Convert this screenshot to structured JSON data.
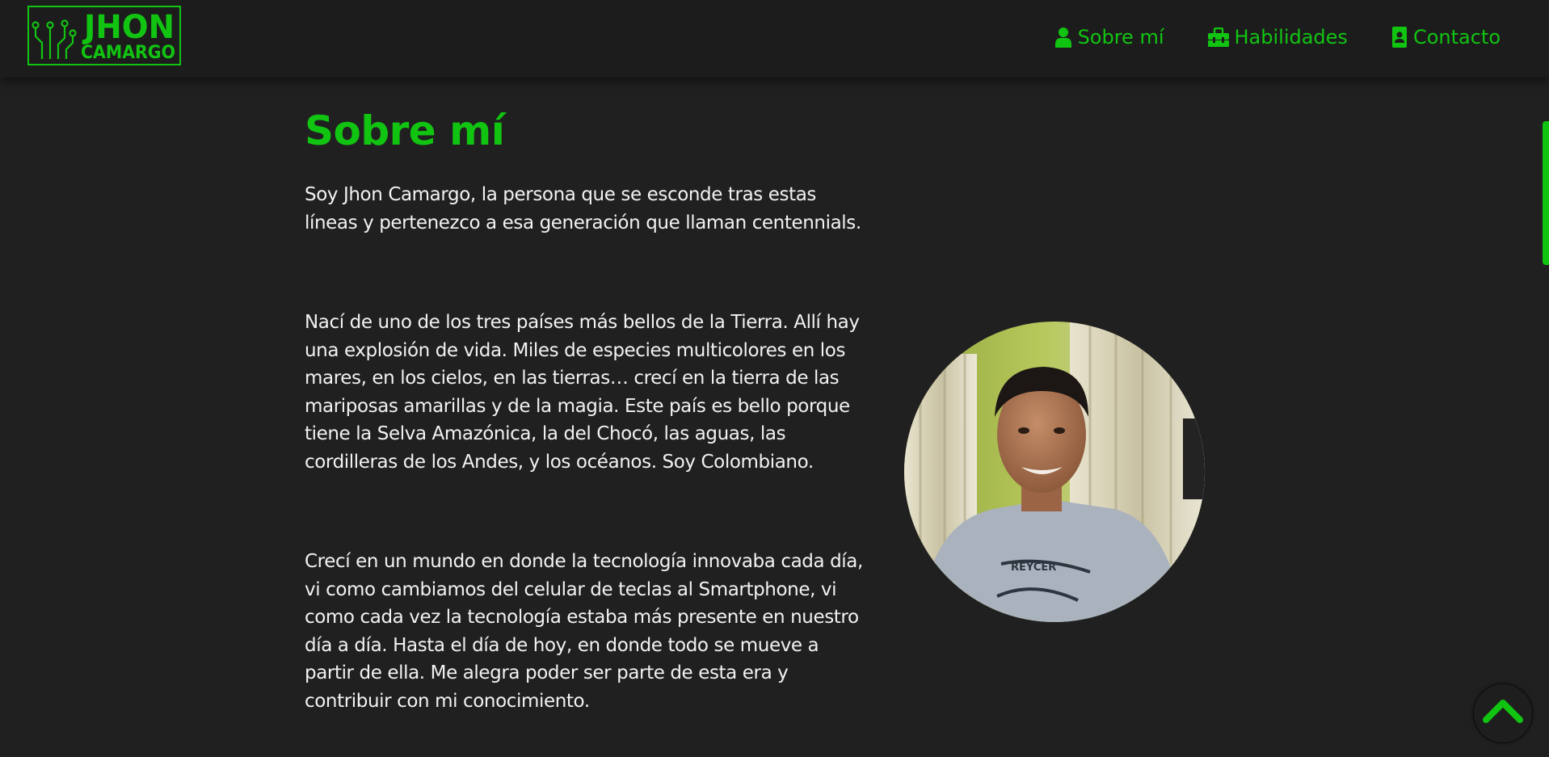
{
  "brand": {
    "line1": "JHON",
    "line2": "CAMARGO",
    "accent_color": "#12c412"
  },
  "nav": [
    {
      "icon": "user-icon",
      "label": "Sobre mí"
    },
    {
      "icon": "toolbox-icon",
      "label": "Habilidades"
    },
    {
      "icon": "contact-card-icon",
      "label": "Contacto"
    }
  ],
  "about": {
    "title": "Sobre mí",
    "paragraphs": [
      "Soy Jhon Camargo, la persona que se esconde tras estas líneas y pertenezco a esa generación que llaman centennials.",
      "Nací de uno de los tres países más bellos de la Tierra. Allí hay una explosión de vida. Miles de especies multicolores en los mares, en los cielos, en las tierras… crecí en la tierra de las mariposas amarillas y de la magia. Este país es bello porque tiene la Selva Amazónica, la del Chocó, las aguas, las cordilleras de los Andes, y los océanos. Soy Colombiano.",
      "Crecí en un mundo en donde la tecnología innovaba cada día, vi como cambiamos del celular de teclas al Smartphone, vi como cada vez la tecnología estaba más presente en nuestro día a día. Hasta el día de hoy, en donde todo se mueve a partir de ella. Me alegra poder ser parte de esta era y contribuir con mi conocimiento."
    ],
    "photo_shirt_text": "REYCER"
  },
  "back_to_top": {
    "icon": "chevron-up-icon"
  }
}
